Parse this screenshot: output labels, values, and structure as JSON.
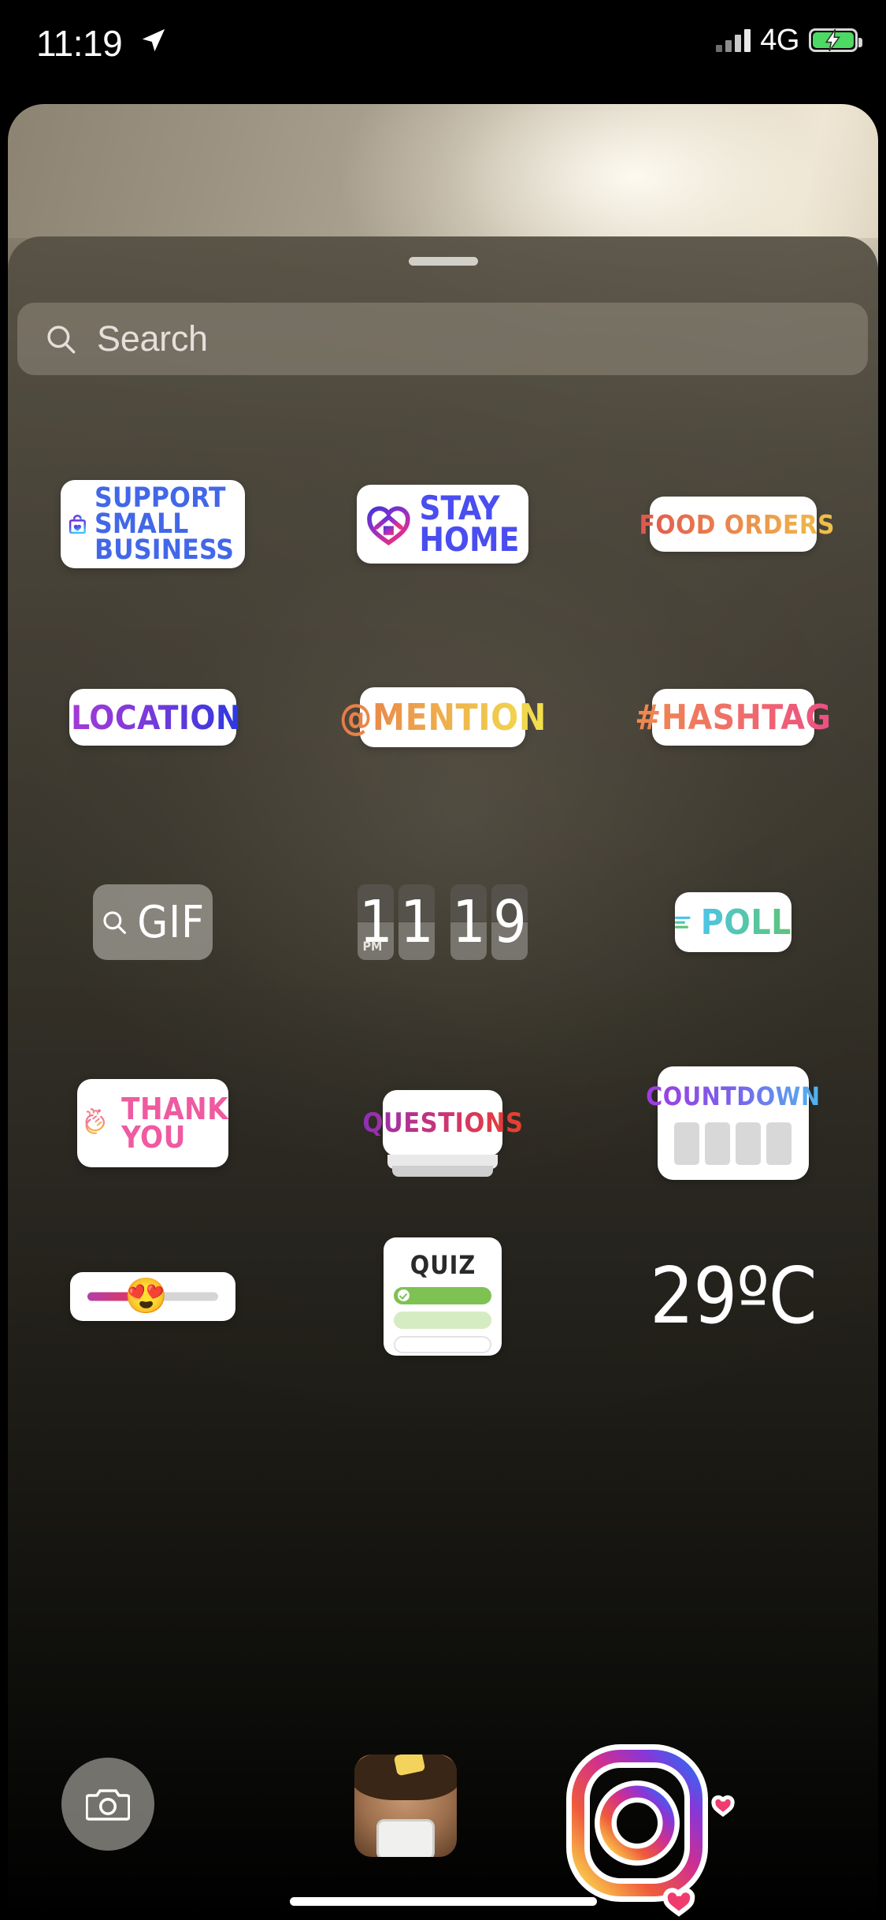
{
  "status_bar": {
    "time": "11:19",
    "location_icon": "location-arrow-icon",
    "network": "4G",
    "signal_icon": "signal-bars-icon",
    "battery_icon": "battery-charging-icon"
  },
  "sheet": {
    "grabber": "sheet-drag-handle"
  },
  "search": {
    "icon": "search-icon",
    "placeholder": "Search"
  },
  "stickers": {
    "support_small_business": {
      "label": "SUPPORT\nSMALL\nBUSINESS",
      "line1": "SUPPORT",
      "line2": "SMALL",
      "line3": "BUSINESS",
      "icon": "shopping-bag-heart-icon",
      "text_color": "#4267e8",
      "icon_gradient": [
        "#7b29d6",
        "#3fa9f5"
      ]
    },
    "stay_home": {
      "line1": "STAY",
      "line2": "HOME",
      "icon": "heart-house-icon",
      "text_color": "#4a4df0",
      "icon_gradient": [
        "#4a35d6",
        "#ed2f7e"
      ]
    },
    "food_orders": {
      "label": "FOOD ORDERS",
      "icon": "delivery-truck-icon",
      "gradient": [
        "#e0564f",
        "#f0c24a"
      ]
    },
    "location": {
      "label": "LOCATION",
      "icon": "map-pin-icon",
      "gradient": [
        "#a33bd6",
        "#2b38e0"
      ]
    },
    "mention": {
      "label": "@MENTION",
      "gradient": [
        "#e8794a",
        "#f2e24e"
      ]
    },
    "hashtag": {
      "label": "#HASHTAG",
      "gradient": [
        "#ef8a4e",
        "#ed4f84"
      ]
    },
    "gif": {
      "label": "GIF",
      "icon": "search-icon"
    },
    "time": {
      "digits": [
        "1",
        "1",
        "1",
        "9"
      ],
      "meridiem": "PM",
      "display": "11 19"
    },
    "poll": {
      "label": "POLL",
      "icon": "poll-bars-icon",
      "gradient": [
        "#4fc3e8",
        "#5ec47a"
      ]
    },
    "thank_you": {
      "line1": "THANK",
      "line2": "YOU",
      "icon": "clapping-hands-icon",
      "text_color": "#ef5aa0",
      "icon_gradient": [
        "#f06fa4",
        "#f2b44e"
      ]
    },
    "questions": {
      "label": "QUESTIONS",
      "gradient": [
        "#8e2fb8",
        "#e8412a"
      ]
    },
    "countdown": {
      "label": "COUNTDOWN",
      "gradient": [
        "#a03ae0",
        "#4fb6f0"
      ],
      "blocks": 4
    },
    "emoji_slider": {
      "emoji": "😍",
      "icon": "emoji-slider-icon",
      "fill_percent": 50
    },
    "quiz": {
      "label": "QUIZ",
      "options": [
        "correct",
        "dim",
        "empty"
      ],
      "correct_color": "#7ec253"
    },
    "temperature": {
      "label": "29ºC"
    }
  },
  "bottom_row": {
    "camera": "camera-icon",
    "selfie": "selfie-thumbnail",
    "instagram_sticker": "instagram-logo-sticker"
  },
  "home_indicator": "home-indicator"
}
